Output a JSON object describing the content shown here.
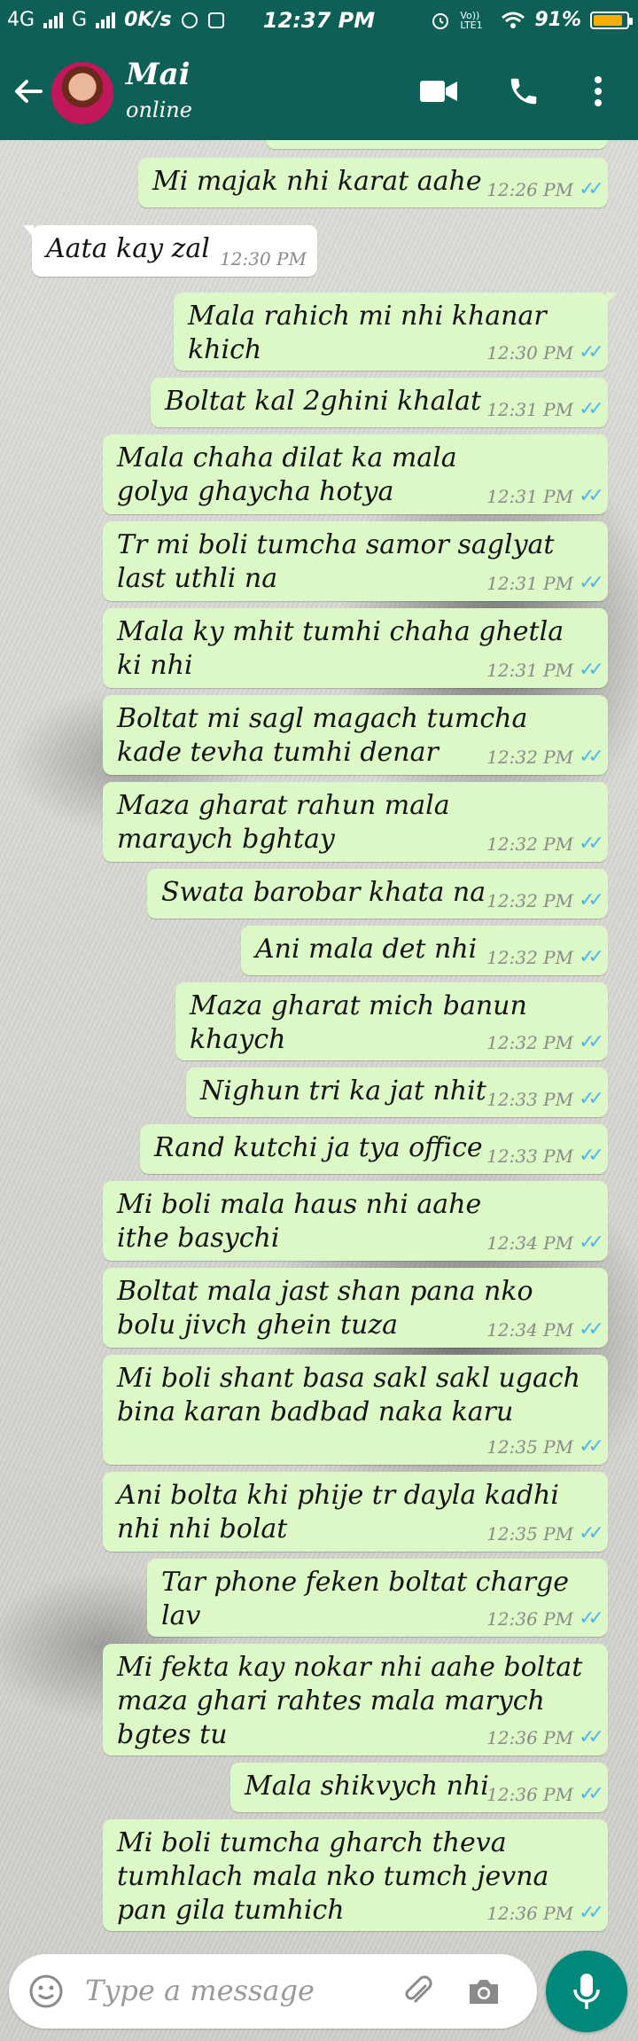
{
  "status_bar": {
    "network1": "4G",
    "network2": "G",
    "speed": "0K/s",
    "time": "12:37 PM",
    "volte": "Vo)) LTE1",
    "battery_percent": "91%",
    "battery_level": 0.91
  },
  "header": {
    "contact_name": "Mai",
    "contact_status": "online"
  },
  "messages": [
    {
      "text": "Mi majak nhi karat aahe",
      "time": "12:26 PM"
    },
    {
      "text": "Aata kay zal",
      "time": "12:30 PM"
    },
    {
      "text": "Mala rahich mi nhi khanar khich",
      "time": "12:30 PM"
    },
    {
      "text": "Boltat kal 2ghini khalat",
      "time": "12:31 PM"
    },
    {
      "text": "Mala chaha dilat ka mala golya ghaycha hotya",
      "time": "12:31 PM"
    },
    {
      "text": "Tr mi boli tumcha samor saglyat last uthli na",
      "time": "12:31 PM"
    },
    {
      "text": "Mala ky mhit tumhi chaha ghetla ki nhi",
      "time": "12:31 PM"
    },
    {
      "text": "Boltat mi sagl magach tumcha kade tevha tumhi denar",
      "time": "12:32 PM"
    },
    {
      "text": "Maza gharat rahun mala maraych bghtay",
      "time": "12:32 PM"
    },
    {
      "text": "Swata barobar khata na",
      "time": "12:32 PM"
    },
    {
      "text": "Ani mala det nhi",
      "time": "12:32 PM"
    },
    {
      "text": "Maza gharat mich banun khaych",
      "time": "12:32 PM"
    },
    {
      "text": "Nighun tri ka jat nhit",
      "time": "12:33 PM"
    },
    {
      "text": "Rand kutchi ja tya office",
      "time": "12:33 PM"
    },
    {
      "text": "Mi boli mala haus nhi aahe ithe basychi",
      "time": "12:34 PM"
    },
    {
      "text": "Boltat mala jast shan pana nko bolu jivch ghein tuza",
      "time": "12:34 PM"
    },
    {
      "text": "Mi boli shant basa sakl sakl ugach bina karan badbad naka karu",
      "time": "12:35 PM"
    },
    {
      "text": "Ani bolta khi phije tr dayla kadhi nhi nhi bolat",
      "time": "12:35 PM"
    },
    {
      "text": "Tar phone feken boltat charge lav",
      "time": "12:36 PM"
    },
    {
      "text": "Mi fekta kay nokar nhi aahe boltat maza ghari rahtes mala marych bgtes tu",
      "time": "12:36 PM"
    },
    {
      "text": "Mala shikvych nhi",
      "time": "12:36 PM"
    },
    {
      "text": "Mi boli tumcha gharch theva tumhlach mala nko tumch jevna pan gila tumhich",
      "time": "12:36 PM"
    }
  ],
  "input": {
    "placeholder": "Type a message"
  },
  "icons": {
    "back": "back-arrow-icon",
    "video": "video-call-icon",
    "call": "phone-icon",
    "menu": "more-vert-icon",
    "emoji": "emoji-icon",
    "attach": "attach-icon",
    "camera": "camera-icon",
    "mic": "mic-icon"
  },
  "colors": {
    "header": "#0e5f56",
    "outgoing_bubble": "#dcf8c6",
    "incoming_bubble": "#ffffff",
    "read_ticks": "#4fb6ec",
    "mic_button": "#00897b",
    "battery": "#f6b100"
  }
}
